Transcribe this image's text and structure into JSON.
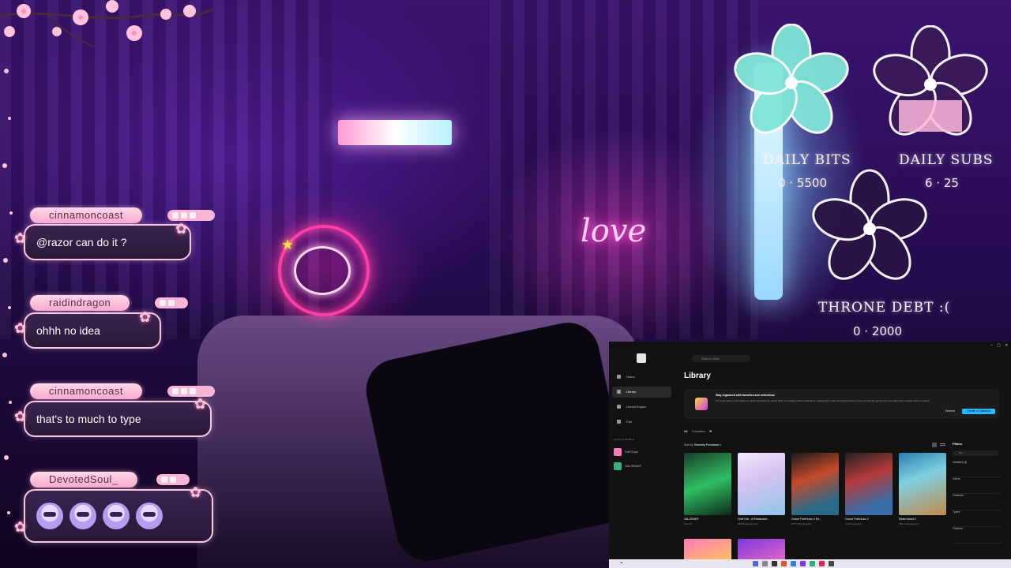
{
  "chat": [
    {
      "username": "cinnamoncoast",
      "message": "@razor can do it ?"
    },
    {
      "username": "raidindragon",
      "message": "ohhh no idea"
    },
    {
      "username": "cinnamoncoast",
      "message": "that's to much to type"
    },
    {
      "username": "DevotedSoul_",
      "message": ""
    }
  ],
  "goals": {
    "bits": {
      "title": "DAILY BITS",
      "value": "0 · 5500"
    },
    "subs": {
      "title": "DAILY SUBS",
      "value": "6 · 25"
    },
    "throne": {
      "title": "THRONE DEBT :(",
      "value": "0 · 2000"
    }
  },
  "scene": {
    "love_sign": "love"
  },
  "launcher": {
    "search_placeholder": "Search store",
    "nav": [
      "Home",
      "Library",
      "Unreal Engine",
      "Fab"
    ],
    "quick_launch_label": "QUICK LAUNCH",
    "quick_launch": [
      "Fall Guys",
      "VALORANT"
    ],
    "title": "Library",
    "banner": {
      "heading": "Stay organized with favorites and collections",
      "text": "Too many titles in your library to easily find what you want? Start by creating custom collections, change their order via drag and drop or pin your favorite games into one place with a simple click of a heart!",
      "dismiss": "Dismiss",
      "create": "Create a Collection"
    },
    "tabs": [
      "All",
      "Favorites"
    ],
    "sort_label": "Sort by:",
    "sort_value": "Recently Purchased",
    "games": [
      {
        "name": "VALORANT",
        "status": "Launch"
      },
      {
        "name": "Chef Life - A Restaurant...",
        "status": "0/50 Achievements"
      },
      {
        "name": "Grand Theft Auto V En...",
        "status": "0/77 Achievements"
      },
      {
        "name": "Grand Theft Auto V",
        "status": "0 Achievements"
      },
      {
        "name": "Dead Island 2",
        "status": "0/50 Achievements"
      }
    ],
    "filters": {
      "heading": "Filters",
      "search": "title",
      "items": [
        "Installed (3)",
        "Genre",
        "Features",
        "Types",
        "Platform"
      ]
    }
  },
  "colors": {
    "accent": "#26bbff",
    "chat_name_bg": "#f6a9cf",
    "neon_pink": "#ff3fa8"
  }
}
